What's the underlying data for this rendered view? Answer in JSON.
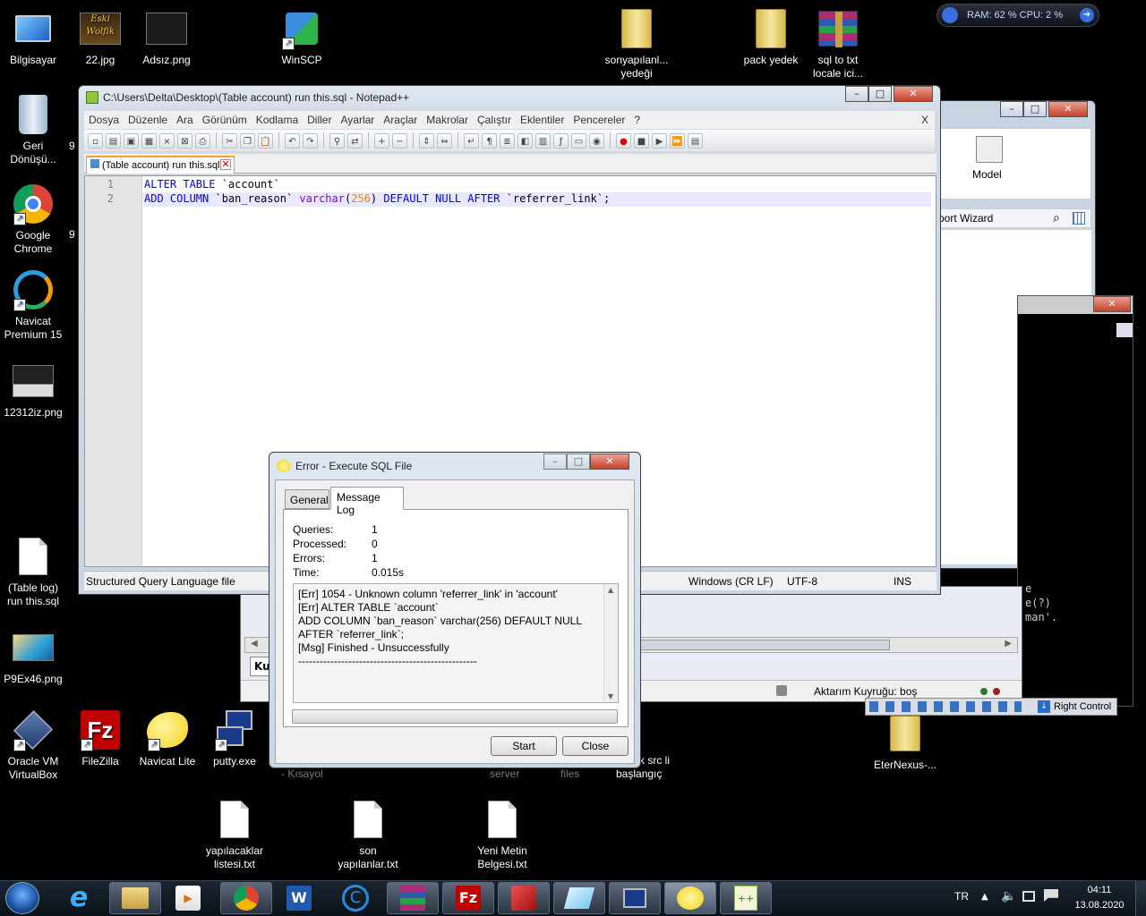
{
  "desktop": {
    "icons_left": [
      {
        "label": "Bilgisayar",
        "icon": "computer-icon"
      },
      {
        "label": "22.jpg",
        "icon": "image-thumbnail-icon"
      },
      {
        "label": "Adsız.png",
        "icon": "image-thumbnail-icon"
      },
      {
        "label": "WinSCP",
        "icon": "winscp-icon"
      },
      {
        "label": "Geri Dönüşü...",
        "icon": "recycle-bin-icon"
      },
      {
        "label": "Google Chrome",
        "icon": "chrome-icon"
      },
      {
        "label": "Navicat Premium 15",
        "icon": "navicat-premium-icon"
      },
      {
        "label": "12312iz.png",
        "icon": "image-thumbnail-icon"
      },
      {
        "label": "(Table log) run this.sql",
        "icon": "file-icon"
      },
      {
        "label": "P9Ex46.png",
        "icon": "image-thumbnail-icon"
      },
      {
        "label": "Oracle VM VirtualBox",
        "icon": "virtualbox-icon"
      },
      {
        "label": "FileZilla",
        "icon": "filezilla-icon"
      },
      {
        "label": "Navicat Lite",
        "icon": "navicat-lite-icon"
      },
      {
        "label": "putty.exe",
        "icon": "putty-icon"
      }
    ],
    "icons_top": [
      {
        "label": "sonyapılanl... yedeği",
        "icon": "folder-icon"
      },
      {
        "label": "pack yedek",
        "icon": "folder-icon"
      },
      {
        "label": "sql to txt locale ici...",
        "icon": "winrar-icon"
      }
    ],
    "icons_bottom": [
      {
        "label": "yapılacaklar listesi.txt",
        "icon": "text-file-icon"
      },
      {
        "label": "son yapılanlar.txt",
        "icon": "text-file-icon"
      },
      {
        "label": "Yeni Metin Belgesi.txt",
        "icon": "text-file-icon"
      },
      {
        "label": "EterNexus-...",
        "icon": "folder-icon"
      }
    ],
    "partial_labels": [
      "9",
      "9",
      "- Kısayol",
      "server",
      "files",
      "k src li",
      "başlangıç",
      "Kı"
    ]
  },
  "monitor_widget": {
    "text": "RAM: 62 %  CPU: 2 %"
  },
  "notepad": {
    "title": "C:\\Users\\Delta\\Desktop\\(Table account) run this.sql - Notepad++",
    "menu": [
      "Dosya",
      "Düzenle",
      "Ara",
      "Görünüm",
      "Kodlama",
      "Diller",
      "Ayarlar",
      "Araçlar",
      "Makrolar",
      "Çalıştır",
      "Eklentiler",
      "Pencereler",
      "?"
    ],
    "menu_close": "X",
    "tab": "(Table account) run this.sql",
    "lines": [
      {
        "num": "1",
        "parts": [
          {
            "t": "ALTER TABLE",
            "c": "kw"
          },
          {
            "t": " `account`",
            "c": "str"
          }
        ]
      },
      {
        "num": "2",
        "parts": [
          {
            "t": "ADD COLUMN",
            "c": "kw"
          },
          {
            "t": " `ban_reason` ",
            "c": "str"
          },
          {
            "t": "varchar",
            "c": "fn"
          },
          {
            "t": "(",
            "c": "str"
          },
          {
            "t": "256",
            "c": "num"
          },
          {
            "t": ") ",
            "c": "str"
          },
          {
            "t": "DEFAULT NULL AFTER",
            "c": "kw"
          },
          {
            "t": " `referrer_link`;",
            "c": "str"
          }
        ]
      }
    ],
    "status": {
      "lang": "Structured Query Language file",
      "eol": "Windows (CR LF)",
      "encoding": "UTF-8",
      "mode": "INS"
    }
  },
  "navicat_bg": {
    "model_label": "Model",
    "wizard_label": "port Wizard",
    "queue_label": "Aktarım Kuyruğu: boş",
    "tab_partial": "Ku"
  },
  "terminal_bg": {
    "lines": [
      "e",
      "e(?)",
      "man'."
    ]
  },
  "vbox": {
    "right_control": "Right Control"
  },
  "dialog": {
    "title": "Error - Execute SQL File",
    "tabs": [
      "General",
      "Message Log"
    ],
    "stats": [
      {
        "label": "Queries:",
        "value": "1"
      },
      {
        "label": "Processed:",
        "value": "0"
      },
      {
        "label": "Errors:",
        "value": "1"
      },
      {
        "label": "Time:",
        "value": "0.015s"
      }
    ],
    "log": [
      "[Err] 1054 - Unknown column 'referrer_link' in 'account'",
      "[Err] ALTER TABLE `account`",
      "ADD COLUMN `ban_reason` varchar(256) DEFAULT NULL",
      "AFTER `referrer_link`;",
      "[Msg] Finished - Unsuccessfully",
      "--------------------------------------------------"
    ],
    "start_label": "Start",
    "close_label": "Close"
  },
  "taskbar": {
    "lang": "TR",
    "time": "04:11",
    "date": "13.08.2020",
    "apps": [
      "start-orb-icon",
      "internet-explorer-icon",
      "file-explorer-icon",
      "media-player-icon",
      "chrome-icon",
      "word-icon",
      "ccleaner-icon",
      "winrar-icon",
      "filezilla-icon",
      "app-red-icon",
      "glass-app-icon",
      "putty-icon",
      "navicat-lite-icon",
      "notepadpp-icon"
    ]
  }
}
